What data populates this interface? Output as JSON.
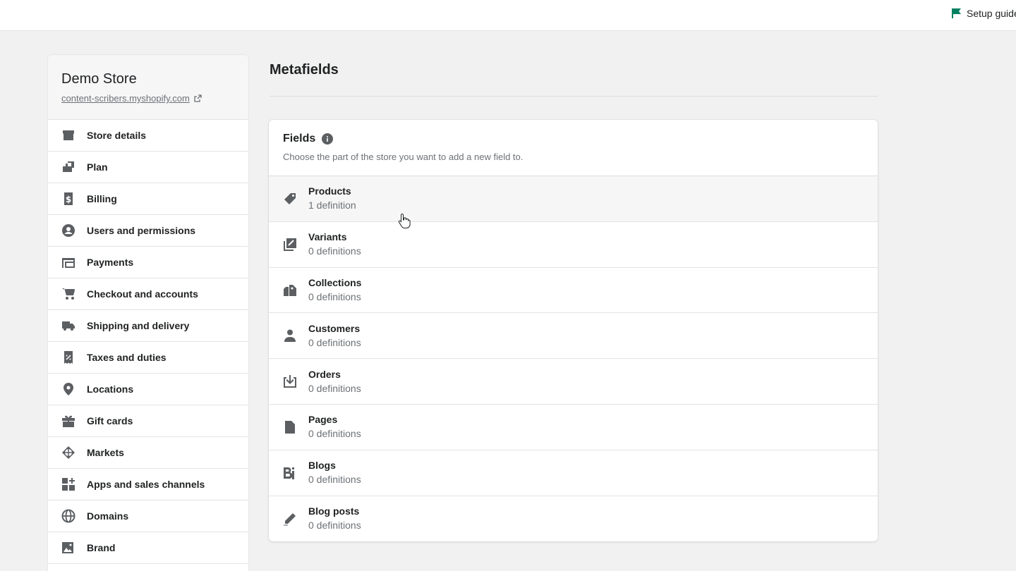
{
  "topbar": {
    "setup_guide": "Setup guide"
  },
  "store": {
    "name": "Demo Store",
    "url": "content-scribers.myshopify.com"
  },
  "sidebar": {
    "items": [
      {
        "label": "Store details",
        "icon": "store-icon"
      },
      {
        "label": "Plan",
        "icon": "plan-icon"
      },
      {
        "label": "Billing",
        "icon": "billing-icon"
      },
      {
        "label": "Users and permissions",
        "icon": "user-circle-icon"
      },
      {
        "label": "Payments",
        "icon": "payments-icon"
      },
      {
        "label": "Checkout and accounts",
        "icon": "cart-icon"
      },
      {
        "label": "Shipping and delivery",
        "icon": "truck-icon"
      },
      {
        "label": "Taxes and duties",
        "icon": "tax-receipt-icon"
      },
      {
        "label": "Locations",
        "icon": "location-pin-icon"
      },
      {
        "label": "Gift cards",
        "icon": "gift-icon"
      },
      {
        "label": "Markets",
        "icon": "globe-markets-icon"
      },
      {
        "label": "Apps and sales channels",
        "icon": "apps-icon"
      },
      {
        "label": "Domains",
        "icon": "globe-icon"
      },
      {
        "label": "Brand",
        "icon": "brand-icon"
      }
    ]
  },
  "main": {
    "title": "Metafields",
    "card": {
      "title": "Fields",
      "subtitle": "Choose the part of the store you want to add a new field to.",
      "rows": [
        {
          "name": "Products",
          "count": "1 definition",
          "icon": "tag-icon"
        },
        {
          "name": "Variants",
          "count": "0 definitions",
          "icon": "variants-icon"
        },
        {
          "name": "Collections",
          "count": "0 definitions",
          "icon": "collections-icon"
        },
        {
          "name": "Customers",
          "count": "0 definitions",
          "icon": "customer-icon"
        },
        {
          "name": "Orders",
          "count": "0 definitions",
          "icon": "orders-icon"
        },
        {
          "name": "Pages",
          "count": "0 definitions",
          "icon": "page-icon"
        },
        {
          "name": "Blogs",
          "count": "0 definitions",
          "icon": "blog-icon"
        },
        {
          "name": "Blog posts",
          "count": "0 definitions",
          "icon": "pencil-icon"
        }
      ]
    }
  },
  "colors": {
    "accent": "#008060",
    "hover_row": "#f6f6f7",
    "icon": "#5c5f62"
  }
}
